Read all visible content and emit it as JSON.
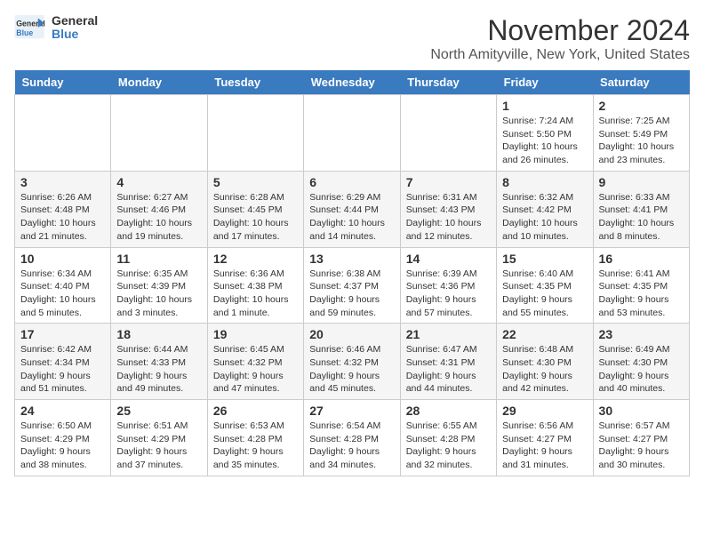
{
  "header": {
    "logo_line1": "General",
    "logo_line2": "Blue",
    "month": "November 2024",
    "location": "North Amityville, New York, United States"
  },
  "weekdays": [
    "Sunday",
    "Monday",
    "Tuesday",
    "Wednesday",
    "Thursday",
    "Friday",
    "Saturday"
  ],
  "weeks": [
    [
      {
        "day": "",
        "info": ""
      },
      {
        "day": "",
        "info": ""
      },
      {
        "day": "",
        "info": ""
      },
      {
        "day": "",
        "info": ""
      },
      {
        "day": "",
        "info": ""
      },
      {
        "day": "1",
        "info": "Sunrise: 7:24 AM\nSunset: 5:50 PM\nDaylight: 10 hours and 26 minutes."
      },
      {
        "day": "2",
        "info": "Sunrise: 7:25 AM\nSunset: 5:49 PM\nDaylight: 10 hours and 23 minutes."
      }
    ],
    [
      {
        "day": "3",
        "info": "Sunrise: 6:26 AM\nSunset: 4:48 PM\nDaylight: 10 hours and 21 minutes."
      },
      {
        "day": "4",
        "info": "Sunrise: 6:27 AM\nSunset: 4:46 PM\nDaylight: 10 hours and 19 minutes."
      },
      {
        "day": "5",
        "info": "Sunrise: 6:28 AM\nSunset: 4:45 PM\nDaylight: 10 hours and 17 minutes."
      },
      {
        "day": "6",
        "info": "Sunrise: 6:29 AM\nSunset: 4:44 PM\nDaylight: 10 hours and 14 minutes."
      },
      {
        "day": "7",
        "info": "Sunrise: 6:31 AM\nSunset: 4:43 PM\nDaylight: 10 hours and 12 minutes."
      },
      {
        "day": "8",
        "info": "Sunrise: 6:32 AM\nSunset: 4:42 PM\nDaylight: 10 hours and 10 minutes."
      },
      {
        "day": "9",
        "info": "Sunrise: 6:33 AM\nSunset: 4:41 PM\nDaylight: 10 hours and 8 minutes."
      }
    ],
    [
      {
        "day": "10",
        "info": "Sunrise: 6:34 AM\nSunset: 4:40 PM\nDaylight: 10 hours and 5 minutes."
      },
      {
        "day": "11",
        "info": "Sunrise: 6:35 AM\nSunset: 4:39 PM\nDaylight: 10 hours and 3 minutes."
      },
      {
        "day": "12",
        "info": "Sunrise: 6:36 AM\nSunset: 4:38 PM\nDaylight: 10 hours and 1 minute."
      },
      {
        "day": "13",
        "info": "Sunrise: 6:38 AM\nSunset: 4:37 PM\nDaylight: 9 hours and 59 minutes."
      },
      {
        "day": "14",
        "info": "Sunrise: 6:39 AM\nSunset: 4:36 PM\nDaylight: 9 hours and 57 minutes."
      },
      {
        "day": "15",
        "info": "Sunrise: 6:40 AM\nSunset: 4:35 PM\nDaylight: 9 hours and 55 minutes."
      },
      {
        "day": "16",
        "info": "Sunrise: 6:41 AM\nSunset: 4:35 PM\nDaylight: 9 hours and 53 minutes."
      }
    ],
    [
      {
        "day": "17",
        "info": "Sunrise: 6:42 AM\nSunset: 4:34 PM\nDaylight: 9 hours and 51 minutes."
      },
      {
        "day": "18",
        "info": "Sunrise: 6:44 AM\nSunset: 4:33 PM\nDaylight: 9 hours and 49 minutes."
      },
      {
        "day": "19",
        "info": "Sunrise: 6:45 AM\nSunset: 4:32 PM\nDaylight: 9 hours and 47 minutes."
      },
      {
        "day": "20",
        "info": "Sunrise: 6:46 AM\nSunset: 4:32 PM\nDaylight: 9 hours and 45 minutes."
      },
      {
        "day": "21",
        "info": "Sunrise: 6:47 AM\nSunset: 4:31 PM\nDaylight: 9 hours and 44 minutes."
      },
      {
        "day": "22",
        "info": "Sunrise: 6:48 AM\nSunset: 4:30 PM\nDaylight: 9 hours and 42 minutes."
      },
      {
        "day": "23",
        "info": "Sunrise: 6:49 AM\nSunset: 4:30 PM\nDaylight: 9 hours and 40 minutes."
      }
    ],
    [
      {
        "day": "24",
        "info": "Sunrise: 6:50 AM\nSunset: 4:29 PM\nDaylight: 9 hours and 38 minutes."
      },
      {
        "day": "25",
        "info": "Sunrise: 6:51 AM\nSunset: 4:29 PM\nDaylight: 9 hours and 37 minutes."
      },
      {
        "day": "26",
        "info": "Sunrise: 6:53 AM\nSunset: 4:28 PM\nDaylight: 9 hours and 35 minutes."
      },
      {
        "day": "27",
        "info": "Sunrise: 6:54 AM\nSunset: 4:28 PM\nDaylight: 9 hours and 34 minutes."
      },
      {
        "day": "28",
        "info": "Sunrise: 6:55 AM\nSunset: 4:28 PM\nDaylight: 9 hours and 32 minutes."
      },
      {
        "day": "29",
        "info": "Sunrise: 6:56 AM\nSunset: 4:27 PM\nDaylight: 9 hours and 31 minutes."
      },
      {
        "day": "30",
        "info": "Sunrise: 6:57 AM\nSunset: 4:27 PM\nDaylight: 9 hours and 30 minutes."
      }
    ]
  ]
}
